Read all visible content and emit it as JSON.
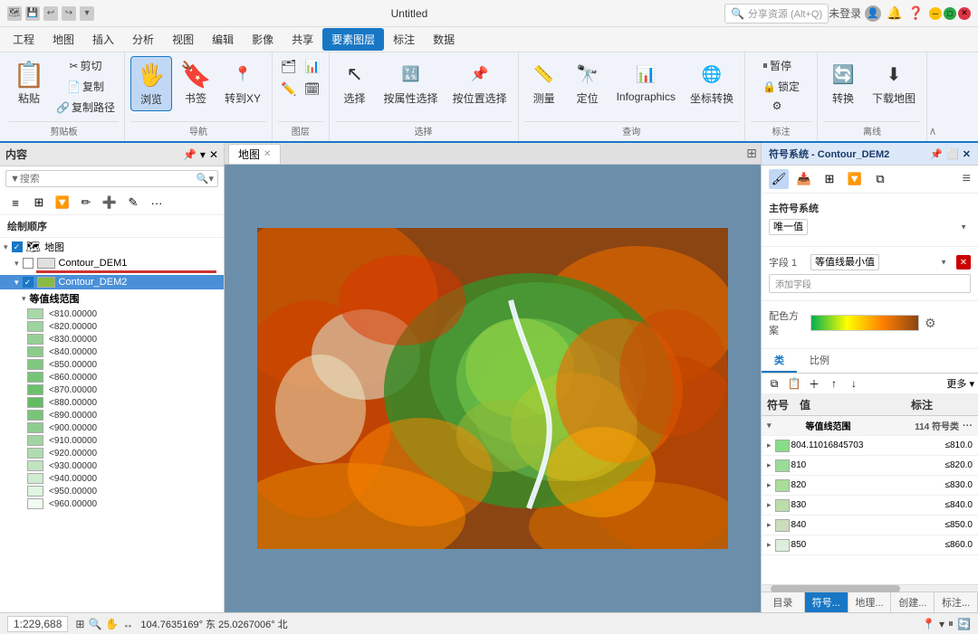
{
  "titleBar": {
    "title": "Untitled",
    "searchPlaceholder": "分享资源 (Alt+Q)",
    "user": "未登录",
    "windowButtons": [
      "minimize",
      "maximize",
      "close"
    ]
  },
  "menuBar": {
    "items": [
      "工程",
      "地图",
      "插入",
      "分析",
      "视图",
      "编辑",
      "影像",
      "共享",
      "要素图层",
      "标注",
      "数据"
    ],
    "active": "要素图层"
  },
  "ribbon": {
    "groups": [
      {
        "name": "剪贴板",
        "label": "剪贴板",
        "buttons": [
          "粘贴",
          "剪切",
          "复制",
          "复制路径"
        ]
      },
      {
        "name": "导航",
        "label": "导航",
        "buttons": [
          "浏览",
          "书签",
          "转到XY"
        ]
      },
      {
        "name": "图层",
        "label": "图层"
      },
      {
        "name": "选择",
        "label": "选择",
        "buttons": [
          "选择",
          "按属性选择",
          "按位置选择"
        ]
      },
      {
        "name": "查询",
        "label": "查询",
        "buttons": [
          "测量",
          "定位",
          "Infographics",
          "坐标转换"
        ]
      },
      {
        "name": "标注",
        "label": "标注"
      },
      {
        "name": "离线",
        "label": "离线",
        "buttons": [
          "转换",
          "下载地图"
        ]
      }
    ]
  },
  "sidebar": {
    "title": "内容",
    "searchPlaceholder": "搜索",
    "drawOrderLabel": "绘制顺序",
    "layers": [
      {
        "name": "地图",
        "type": "group",
        "expanded": true,
        "checked": true
      },
      {
        "name": "Contour_DEM1",
        "type": "layer",
        "checked": false,
        "color": "#cc6600"
      },
      {
        "name": "Contour_DEM2",
        "type": "layer",
        "checked": true,
        "color": "#88bb44",
        "selected": true
      },
      {
        "name": "等值线范围",
        "type": "sublabel"
      }
    ],
    "legendItems": [
      {
        "value": "<810.00000",
        "color": "#a8d8a8"
      },
      {
        "value": "<820.00000",
        "color": "#b0dab0"
      },
      {
        "value": "<830.00000",
        "color": "#b8dcb8"
      },
      {
        "value": "<840.00000",
        "color": "#c0dec0"
      },
      {
        "value": "<850.00000",
        "color": "#c8e0c8"
      },
      {
        "value": "<860.00000",
        "color": "#d0e8d0"
      },
      {
        "value": "<870.00000",
        "color": "#d8ead8"
      },
      {
        "value": "<880.00000",
        "color": "#e0ece0"
      },
      {
        "value": "<890.00000",
        "color": "#e8eee8"
      },
      {
        "value": "<900.00000",
        "color": "#f0f0f0"
      },
      {
        "value": "<910.00000",
        "color": "#e8e0d8"
      },
      {
        "value": "<920.00000",
        "color": "#e0d0c0"
      },
      {
        "value": "<930.00000",
        "color": "#d8c0a8"
      },
      {
        "value": "<940.00000",
        "color": "#d0b090"
      },
      {
        "value": "<950.00000",
        "color": "#c8a078"
      },
      {
        "value": "<960.00000",
        "color": "#c09060"
      }
    ]
  },
  "mapArea": {
    "tabLabel": "地图",
    "scale": "1:229,688",
    "coordinates": "104.7635169°东 25.0267006°北"
  },
  "symbolPanel": {
    "title": "符号系统 - Contour_DEM2",
    "mainSystem": "主符号系统",
    "systemType": "唯一值",
    "field1Label": "字段 1",
    "field1Value": "等值线最小值",
    "addFieldLabel": "添加字段",
    "colorSchemeLabel": "配色方案",
    "tabs": [
      "类",
      "比例"
    ],
    "activeTab": "类",
    "tableHeaders": [
      "符号",
      "值",
      "标注"
    ],
    "tableActions": [
      "copy",
      "add",
      "up",
      "down",
      "more"
    ],
    "groupRow": {
      "label": "等值线范围",
      "count": "114 符号类",
      "dots": "..."
    },
    "dataRows": [
      {
        "value": "804.11016845703",
        "label": "≤810.0",
        "color": "#88dd88"
      },
      {
        "value": "810",
        "label": "≤820.0",
        "color": "#99dd99"
      },
      {
        "value": "820",
        "label": "≤830.0",
        "color": "#aadd99"
      },
      {
        "value": "830",
        "label": "≤840.0",
        "color": "#bbddaa"
      },
      {
        "value": "840",
        "label": "≤850.0",
        "color": "#ccddbb"
      },
      {
        "value": "850",
        "label": "≤860.0",
        "color": "#ddeedd"
      }
    ],
    "bottomTabs": [
      "目录",
      "符号...",
      "地理...",
      "创建...",
      "标注..."
    ],
    "activeBottomTab": "符号..."
  },
  "statusBar": {
    "scale": "1:229,688",
    "coordinates": "104.7635169° 东 25.0267006° 北"
  }
}
